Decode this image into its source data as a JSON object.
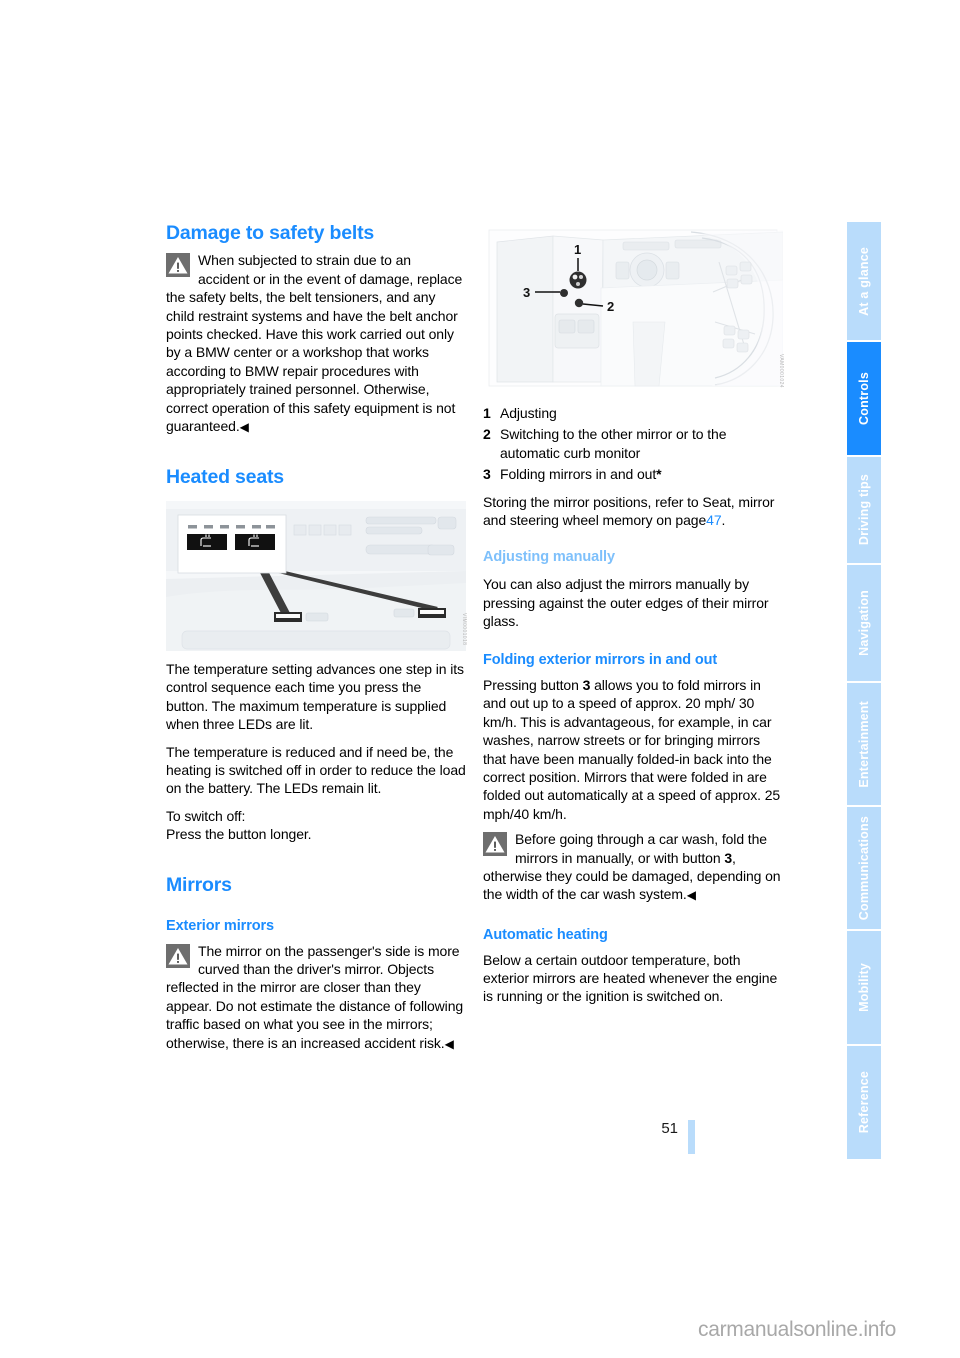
{
  "page": {
    "number": "51",
    "watermark": "carmanualsonline.info"
  },
  "sidebar": {
    "tabs": [
      {
        "label": "At a glance",
        "active": false
      },
      {
        "label": "Controls",
        "active": true
      },
      {
        "label": "Driving tips",
        "active": false
      },
      {
        "label": "Navigation",
        "active": false
      },
      {
        "label": "Entertainment",
        "active": false
      },
      {
        "label": "Communications",
        "active": false
      },
      {
        "label": "Mobility",
        "active": false
      },
      {
        "label": "Reference",
        "active": false
      }
    ]
  },
  "left_column": {
    "damage_heading": "Damage to safety belts",
    "damage_warning": "When subjected to strain due to an accident or in the event of damage, replace the safety belts, the belt tensioners, and any child restraint systems and have the belt anchor points checked. Have this work carried out only by a BMW center or a workshop that works according to BMW repair procedures with appropriately trained personnel. Otherwise, correct operation of this safety equipment is not guaranteed.",
    "heated_seats_heading": "Heated seats",
    "heated_seats_figure_code": "VIM0001018",
    "heated_p1": "The temperature setting advances one step in its control sequence each time you press the button. The maximum temperature is supplied when three LEDs are lit.",
    "heated_p2": "The temperature is reduced and if need be, the heating is switched off in order to reduce the load on the battery. The LEDs remain lit.",
    "heated_p3_line1": "To switch off:",
    "heated_p3_line2": "Press the button longer.",
    "mirrors_heading": "Mirrors",
    "exterior_mirrors_heading": "Exterior mirrors",
    "exterior_mirrors_warning": "The mirror on the passenger's side is more curved than the driver's mirror. Objects reflected in the mirror are closer than they appear. Do not estimate the distance of following traffic based on what you see in the mirrors; otherwise, there is an increased accident risk."
  },
  "right_column": {
    "mirror_figure_code": "VAM0001024",
    "mirror_figure_callouts": [
      "1",
      "2",
      "3"
    ],
    "controls_list": [
      {
        "num": "1",
        "text": "Adjusting"
      },
      {
        "num": "2",
        "text": "Switching to the other mirror or to the automatic curb monitor"
      },
      {
        "num": "3",
        "text": "Folding mirrors in and out",
        "star": "*"
      }
    ],
    "storing_text_before": "Storing the mirror positions, refer to Seat, mirror and steering wheel memory on page",
    "storing_xref": "47",
    "storing_text_after": ".",
    "adjusting_manually_heading": "Adjusting manually",
    "adjusting_manually_body": "You can also adjust the mirrors manually by pressing against the outer edges of their mirror glass.",
    "folding_heading": "Folding exterior mirrors in and out",
    "folding_p1_a": "Pressing button",
    "folding_p1_b": "3",
    "folding_p1_c": "allows you to fold mirrors in and out up to a speed of approx. 20 mph/ 30 km/h. This is advantageous, for example, in car washes, narrow streets or for bringing mirrors that have been manually folded-in back into the correct position. Mirrors that were folded in are folded out automatically at a speed of approx. 25 mph/40 km/h.",
    "folding_warning_a": "Before going through a car wash, fold the mirrors in manually, or with button",
    "folding_warning_b": "3",
    "folding_warning_c": ", otherwise they could be damaged, depending on the width of the car wash system.",
    "automatic_heating_heading": "Automatic heating",
    "automatic_heating_body": "Below a certain outdoor temperature, both exterior mirrors are heated whenever the engine is running or the ignition is switched on."
  },
  "colors": {
    "accent_blue": "#1a8cff",
    "light_blue": "#b9dcfb",
    "pale_heading_blue": "#7ec0fb",
    "warning_icon_gray": "#6e6e6e"
  }
}
